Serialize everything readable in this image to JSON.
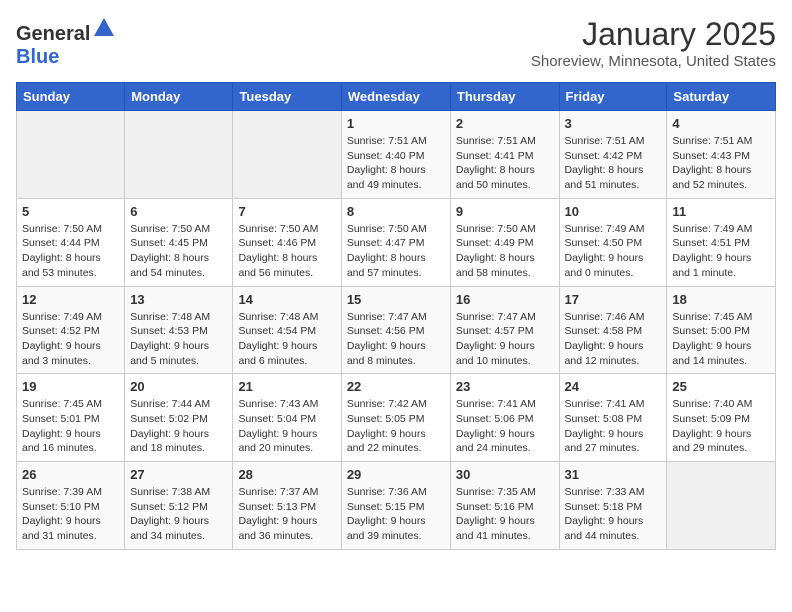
{
  "header": {
    "logo": {
      "general": "General",
      "blue": "Blue"
    },
    "title": "January 2025",
    "subtitle": "Shoreview, Minnesota, United States"
  },
  "days_of_week": [
    "Sunday",
    "Monday",
    "Tuesday",
    "Wednesday",
    "Thursday",
    "Friday",
    "Saturday"
  ],
  "weeks": [
    {
      "days": [
        {
          "number": "",
          "info": ""
        },
        {
          "number": "",
          "info": ""
        },
        {
          "number": "",
          "info": ""
        },
        {
          "number": "1",
          "info": "Sunrise: 7:51 AM\nSunset: 4:40 PM\nDaylight: 8 hours\nand 49 minutes."
        },
        {
          "number": "2",
          "info": "Sunrise: 7:51 AM\nSunset: 4:41 PM\nDaylight: 8 hours\nand 50 minutes."
        },
        {
          "number": "3",
          "info": "Sunrise: 7:51 AM\nSunset: 4:42 PM\nDaylight: 8 hours\nand 51 minutes."
        },
        {
          "number": "4",
          "info": "Sunrise: 7:51 AM\nSunset: 4:43 PM\nDaylight: 8 hours\nand 52 minutes."
        }
      ]
    },
    {
      "days": [
        {
          "number": "5",
          "info": "Sunrise: 7:50 AM\nSunset: 4:44 PM\nDaylight: 8 hours\nand 53 minutes."
        },
        {
          "number": "6",
          "info": "Sunrise: 7:50 AM\nSunset: 4:45 PM\nDaylight: 8 hours\nand 54 minutes."
        },
        {
          "number": "7",
          "info": "Sunrise: 7:50 AM\nSunset: 4:46 PM\nDaylight: 8 hours\nand 56 minutes."
        },
        {
          "number": "8",
          "info": "Sunrise: 7:50 AM\nSunset: 4:47 PM\nDaylight: 8 hours\nand 57 minutes."
        },
        {
          "number": "9",
          "info": "Sunrise: 7:50 AM\nSunset: 4:49 PM\nDaylight: 8 hours\nand 58 minutes."
        },
        {
          "number": "10",
          "info": "Sunrise: 7:49 AM\nSunset: 4:50 PM\nDaylight: 9 hours\nand 0 minutes."
        },
        {
          "number": "11",
          "info": "Sunrise: 7:49 AM\nSunset: 4:51 PM\nDaylight: 9 hours\nand 1 minute."
        }
      ]
    },
    {
      "days": [
        {
          "number": "12",
          "info": "Sunrise: 7:49 AM\nSunset: 4:52 PM\nDaylight: 9 hours\nand 3 minutes."
        },
        {
          "number": "13",
          "info": "Sunrise: 7:48 AM\nSunset: 4:53 PM\nDaylight: 9 hours\nand 5 minutes."
        },
        {
          "number": "14",
          "info": "Sunrise: 7:48 AM\nSunset: 4:54 PM\nDaylight: 9 hours\nand 6 minutes."
        },
        {
          "number": "15",
          "info": "Sunrise: 7:47 AM\nSunset: 4:56 PM\nDaylight: 9 hours\nand 8 minutes."
        },
        {
          "number": "16",
          "info": "Sunrise: 7:47 AM\nSunset: 4:57 PM\nDaylight: 9 hours\nand 10 minutes."
        },
        {
          "number": "17",
          "info": "Sunrise: 7:46 AM\nSunset: 4:58 PM\nDaylight: 9 hours\nand 12 minutes."
        },
        {
          "number": "18",
          "info": "Sunrise: 7:45 AM\nSunset: 5:00 PM\nDaylight: 9 hours\nand 14 minutes."
        }
      ]
    },
    {
      "days": [
        {
          "number": "19",
          "info": "Sunrise: 7:45 AM\nSunset: 5:01 PM\nDaylight: 9 hours\nand 16 minutes."
        },
        {
          "number": "20",
          "info": "Sunrise: 7:44 AM\nSunset: 5:02 PM\nDaylight: 9 hours\nand 18 minutes."
        },
        {
          "number": "21",
          "info": "Sunrise: 7:43 AM\nSunset: 5:04 PM\nDaylight: 9 hours\nand 20 minutes."
        },
        {
          "number": "22",
          "info": "Sunrise: 7:42 AM\nSunset: 5:05 PM\nDaylight: 9 hours\nand 22 minutes."
        },
        {
          "number": "23",
          "info": "Sunrise: 7:41 AM\nSunset: 5:06 PM\nDaylight: 9 hours\nand 24 minutes."
        },
        {
          "number": "24",
          "info": "Sunrise: 7:41 AM\nSunset: 5:08 PM\nDaylight: 9 hours\nand 27 minutes."
        },
        {
          "number": "25",
          "info": "Sunrise: 7:40 AM\nSunset: 5:09 PM\nDaylight: 9 hours\nand 29 minutes."
        }
      ]
    },
    {
      "days": [
        {
          "number": "26",
          "info": "Sunrise: 7:39 AM\nSunset: 5:10 PM\nDaylight: 9 hours\nand 31 minutes."
        },
        {
          "number": "27",
          "info": "Sunrise: 7:38 AM\nSunset: 5:12 PM\nDaylight: 9 hours\nand 34 minutes."
        },
        {
          "number": "28",
          "info": "Sunrise: 7:37 AM\nSunset: 5:13 PM\nDaylight: 9 hours\nand 36 minutes."
        },
        {
          "number": "29",
          "info": "Sunrise: 7:36 AM\nSunset: 5:15 PM\nDaylight: 9 hours\nand 39 minutes."
        },
        {
          "number": "30",
          "info": "Sunrise: 7:35 AM\nSunset: 5:16 PM\nDaylight: 9 hours\nand 41 minutes."
        },
        {
          "number": "31",
          "info": "Sunrise: 7:33 AM\nSunset: 5:18 PM\nDaylight: 9 hours\nand 44 minutes."
        },
        {
          "number": "",
          "info": ""
        }
      ]
    }
  ]
}
